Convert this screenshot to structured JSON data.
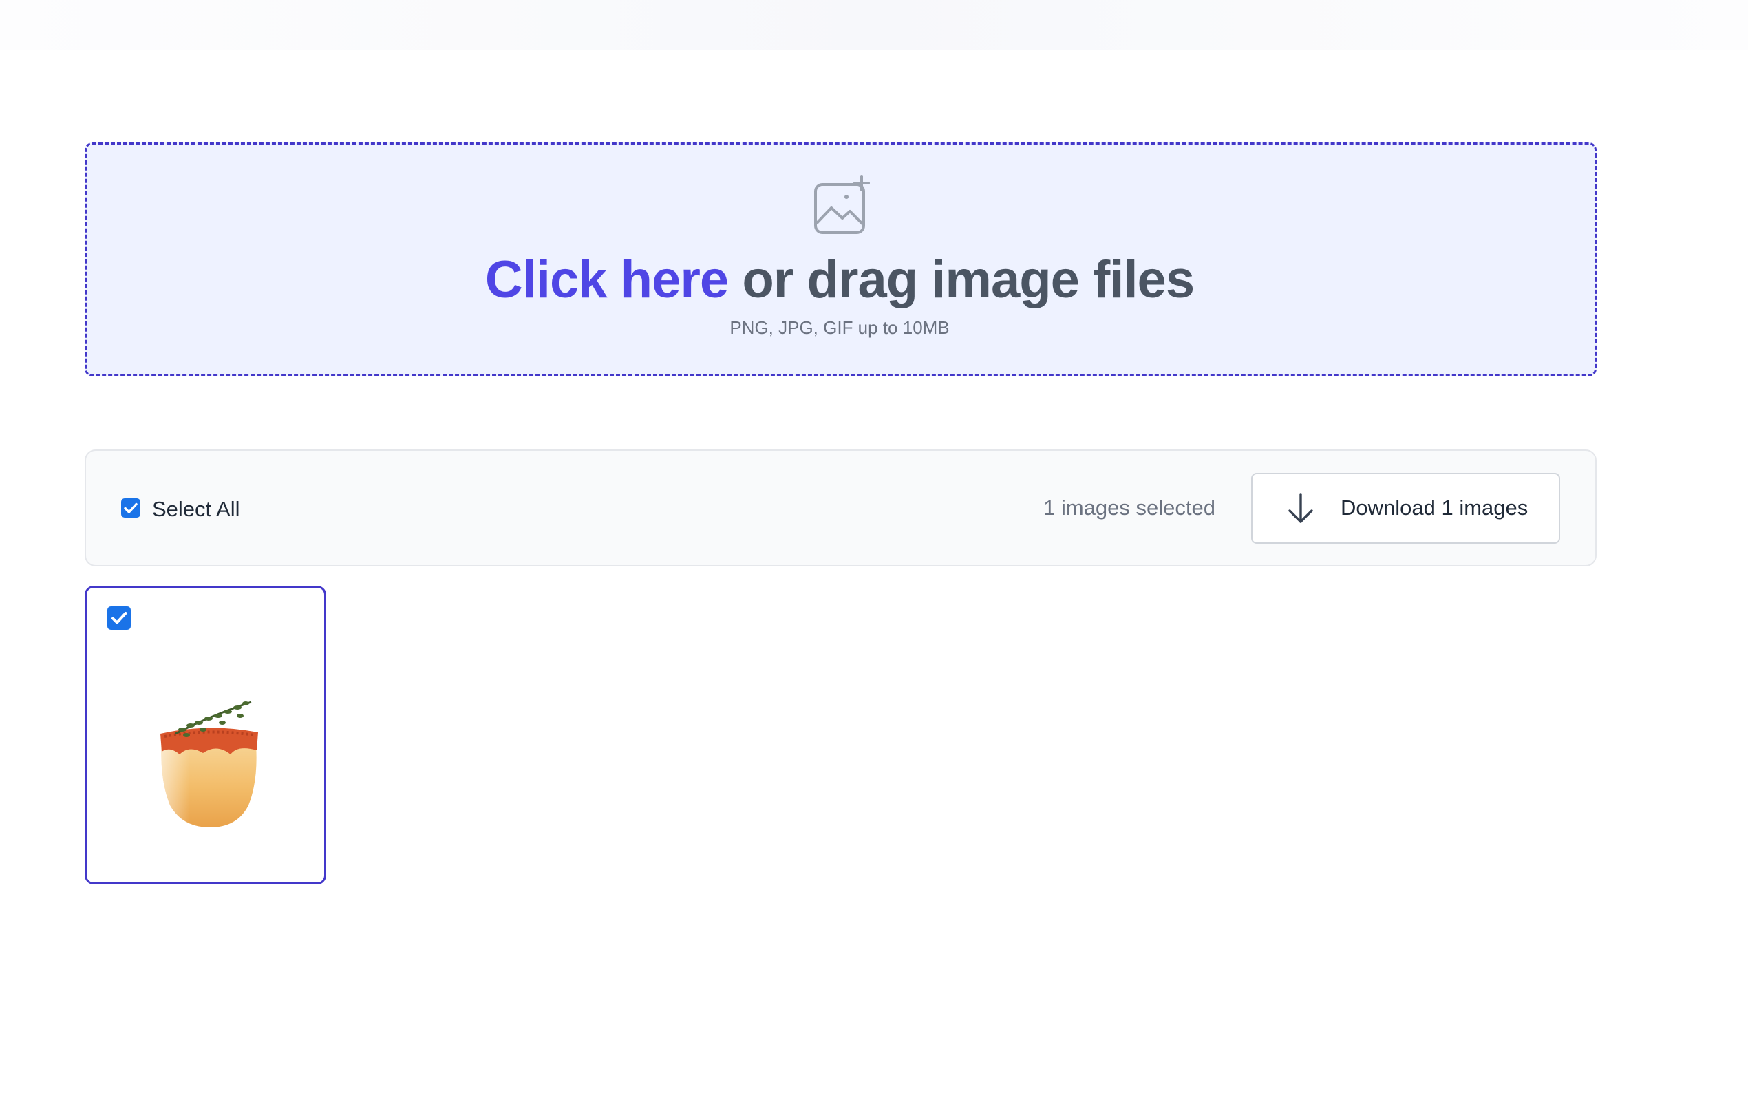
{
  "dropzone": {
    "icon": "image-plus-icon",
    "link_text": "Click here",
    "rest_text": "or drag image files",
    "hint": "PNG, JPG, GIF up to 10MB"
  },
  "toolbar": {
    "select_all_label": "Select All",
    "select_all_checked": true,
    "selected_count_text": "1 images selected",
    "download_icon": "arrow-down-icon",
    "download_label": "Download 1 images"
  },
  "images": [
    {
      "name": "cocktail-thumbnail",
      "checked": true
    }
  ],
  "colors": {
    "accent": "#4f46e5",
    "border_accent": "#4338ca",
    "dropzone_bg": "#eef2ff",
    "checkbox": "#1a73e8",
    "toolbar_bg": "#f9fafb"
  }
}
